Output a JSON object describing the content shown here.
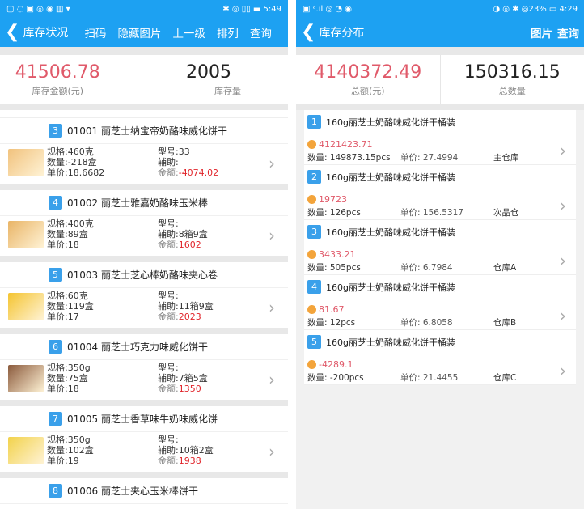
{
  "left": {
    "status": {
      "left_icons": "▢ ◌ ▣ ◎ ◉ ▥ ▾",
      "right": "✱ ◎ ▯▯ ▬ 5:49"
    },
    "appbar": {
      "title": "库存状况",
      "actions": [
        "扫码",
        "隐藏图片",
        "上一级",
        "排列",
        "查询"
      ]
    },
    "summary": {
      "amount_value": "41506.78",
      "amount_label": "库存金额(元)",
      "qty_value": "2005",
      "qty_label": "库存量"
    },
    "items": [
      {
        "index": "3",
        "title": "01001 丽芝士纳宝帝奶酪味威化饼干",
        "spec": "规格:460克",
        "qty": "数量:-218盒",
        "price": "单价:18.6682",
        "model": "型号:33",
        "aux": "辅助:",
        "amount_label": "金额:",
        "amount": "-4074.02",
        "thumb_color": "#f1c27d"
      },
      {
        "index": "4",
        "title": "01002 丽芝士雅嘉奶酪味玉米棒",
        "spec": "规格:400克",
        "qty": "数量:89盒",
        "price": "单价:18",
        "model": "型号:",
        "aux": "辅助:8箱9盒",
        "amount_label": "金额:",
        "amount": "1602",
        "thumb_color": "#e9b466"
      },
      {
        "index": "5",
        "title": "01003 丽芝士芝心棒奶酪味夹心卷",
        "spec": "规格:60克",
        "qty": "数量:119盒",
        "price": "单价:17",
        "model": "型号:",
        "aux": "辅助:11箱9盒",
        "amount_label": "金额:",
        "amount": "2023",
        "thumb_color": "#f4c430"
      },
      {
        "index": "6",
        "title": "01004 丽芝士巧克力味威化饼干",
        "spec": "规格:350g",
        "qty": "数量:75盒",
        "price": "单价:18",
        "model": "型号:",
        "aux": "辅助:7箱5盒",
        "amount_label": "金额:",
        "amount": "1350",
        "thumb_color": "#8b5a3c"
      },
      {
        "index": "7",
        "title": "01005 丽芝士香草味牛奶味威化饼",
        "spec": "规格:350g",
        "qty": "数量:102盒",
        "price": "单价:19",
        "model": "型号:",
        "aux": "辅助:10箱2盒",
        "amount_label": "金额:",
        "amount": "1938",
        "thumb_color": "#f2d24b"
      },
      {
        "index": "8",
        "title": "01006 丽芝士夹心玉米棒饼干",
        "thumb_color": "#e8b24a"
      }
    ]
  },
  "right": {
    "status": {
      "left_icons": "▣ ᵃ.ıl ◎ ◔ ◉",
      "right": "◑ ◎ ✱ ◎23% ▭ 4:29"
    },
    "appbar": {
      "title": "库存分布",
      "actions": [
        "图片",
        "查询"
      ]
    },
    "summary": {
      "amount_value": "4140372.49",
      "amount_label": "总额(元)",
      "qty_value": "150316.15",
      "qty_label": "总数量"
    },
    "items": [
      {
        "index": "1",
        "title": "160g丽芝士奶酪味威化饼干桶装",
        "amount": "4121423.71",
        "qty": "数量: 149873.15pcs",
        "price": "单价: 27.4994",
        "warehouse": "主仓库"
      },
      {
        "index": "2",
        "title": "160g丽芝士奶酪味威化饼干桶装",
        "amount": "19723",
        "qty": "数量: 126pcs",
        "price": "单价: 156.5317",
        "warehouse": "次品仓"
      },
      {
        "index": "3",
        "title": "160g丽芝士奶酪味威化饼干桶装",
        "amount": "3433.21",
        "qty": "数量: 505pcs",
        "price": "单价: 6.7984",
        "warehouse": "仓库A"
      },
      {
        "index": "4",
        "title": "160g丽芝士奶酪味威化饼干桶装",
        "amount": "81.67",
        "qty": "数量: 12pcs",
        "price": "单价: 6.8058",
        "warehouse": "仓库B"
      },
      {
        "index": "5",
        "title": "160g丽芝士奶酪味威化饼干桶装",
        "amount": "-4289.1",
        "qty": "数量: -200pcs",
        "price": "单价: 21.4455",
        "warehouse": "仓库C"
      }
    ]
  },
  "colors": {
    "accent": "#1da1f2",
    "badge": "#3aa0ea",
    "red": "#e0242a",
    "pink": "#e05a6a",
    "coin": "#f3a43b"
  }
}
